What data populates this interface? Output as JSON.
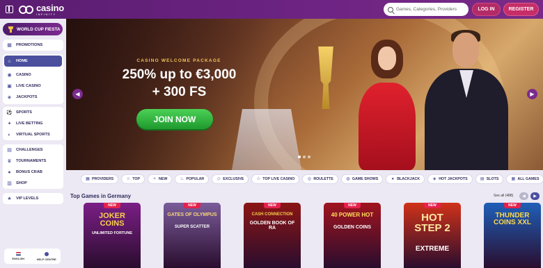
{
  "header": {
    "logo_word": "casino",
    "logo_sub": "INFINITY",
    "search_placeholder": "Games, Categories, Providers",
    "login_label": "LOG IN",
    "register_label": "REGISTER"
  },
  "sidebar": {
    "promo_pill": "WORLD CUP FIESTA",
    "group1": [
      {
        "label": "PROMOTIONS",
        "icon": "promotions-icon"
      }
    ],
    "group2": [
      {
        "label": "HOME",
        "icon": "home-icon"
      },
      {
        "label": "CASINO",
        "icon": "casino-icon"
      },
      {
        "label": "LIVE CASINO",
        "icon": "live-casino-icon"
      },
      {
        "label": "JACKPOTS",
        "icon": "jackpots-icon"
      }
    ],
    "group3": [
      {
        "label": "SPORTS",
        "icon": "sports-icon"
      },
      {
        "label": "LIVE BETTING",
        "icon": "live-betting-icon"
      },
      {
        "label": "VIRTUAL SPORTS",
        "icon": "virtual-sports-icon"
      }
    ],
    "group4": [
      {
        "label": "CHALLENGES",
        "icon": "challenges-icon"
      },
      {
        "label": "TOURNAMENTS",
        "icon": "tournaments-icon"
      },
      {
        "label": "BONUS CRAB",
        "icon": "bonus-crab-icon"
      },
      {
        "label": "SHOP",
        "icon": "shop-icon"
      }
    ],
    "group5": [
      {
        "label": "VIP LEVELS",
        "icon": "vip-icon"
      }
    ],
    "language": "ENGLISH",
    "help": "HELP CENTRE"
  },
  "hero": {
    "kicker": "CASINO WELCOME PACKAGE",
    "title": "250% up to €3,000",
    "subtitle": "+ 300 FS",
    "cta": "JOIN NOW"
  },
  "categories": [
    {
      "label": "PROVIDERS",
      "icon": "providers-icon"
    },
    {
      "label": "TOP",
      "icon": "star-icon"
    },
    {
      "label": "NEW",
      "icon": "new-icon"
    },
    {
      "label": "POPULAR",
      "icon": "fire-icon"
    },
    {
      "label": "EXCLUSIVE",
      "icon": "diamond-icon"
    },
    {
      "label": "TOP LIVE CASINO",
      "icon": "star-icon"
    },
    {
      "label": "ROULETTE",
      "icon": "roulette-icon"
    },
    {
      "label": "GAME SHOWS",
      "icon": "game-shows-icon"
    },
    {
      "label": "BLACKJACK",
      "icon": "blackjack-icon"
    },
    {
      "label": "HOT JACKPOTS",
      "icon": "hot-jackpots-icon"
    },
    {
      "label": "SLOTS",
      "icon": "slots-icon"
    },
    {
      "label": "ALL GAMES",
      "icon": "all-games-icon"
    }
  ],
  "top_games": {
    "title": "Top Games in Germany",
    "see_all": "See all (488)",
    "games": [
      {
        "title": "JOKER COINS",
        "sub": "UNLIMITED FORTUNE",
        "badge": "NEW",
        "bg": "#7b1e86",
        "title_color": "#f8d24a"
      },
      {
        "title": "GATES OF OLYMPUS",
        "sub": "SUPER SCATTER",
        "badge": "NEW",
        "bg": "#7a5c9a",
        "title_color": "#f7d776"
      },
      {
        "title": "CASH CONNECTION",
        "sub": "GOLDEN BOOK OF RA",
        "badge": "NEW",
        "bg": "#8b1515",
        "title_color": "#f5d04c"
      },
      {
        "title": "40 POWER HOT",
        "sub": "GOLDEN COINS",
        "badge": "NEW",
        "bg": "#a0141f",
        "title_color": "#ffe15a"
      },
      {
        "title": "HOT STEP 2",
        "sub": "EXTREME",
        "badge": "NEW",
        "bg": "#d0321a",
        "title_color": "#ffe7a0"
      },
      {
        "title": "THUNDER COINS XXL",
        "sub": "",
        "badge": "NEW",
        "bg": "#1f5fb8",
        "title_color": "#ffd94a"
      }
    ]
  }
}
